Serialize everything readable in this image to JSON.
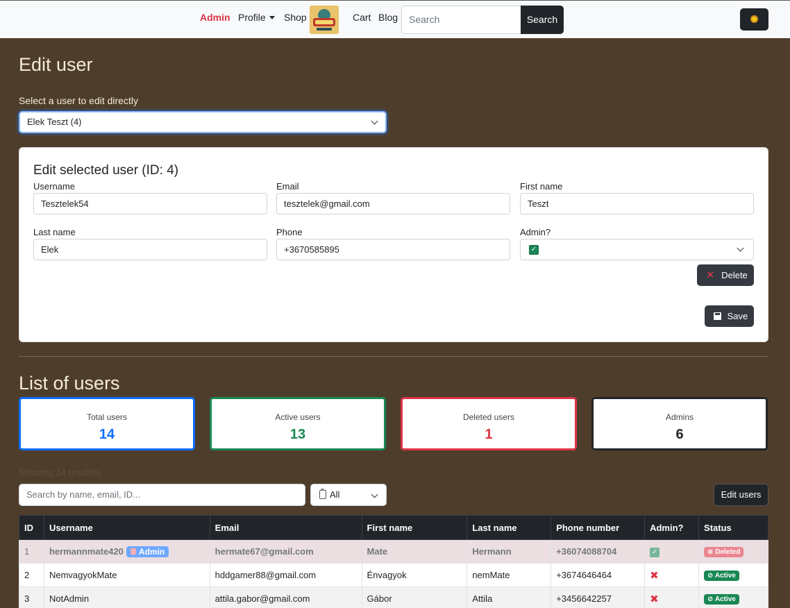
{
  "nav": {
    "admin": "Admin",
    "profile": "Profile",
    "shop": "Shop",
    "cart": "Cart",
    "blog": "Blog",
    "search_placeholder": "Search",
    "search_button": "Search"
  },
  "edit": {
    "title": "Edit user",
    "select_label": "Select a user to edit directly",
    "selected_user": "Elek Teszt (4)",
    "card_title": "Edit selected user (ID: 4)",
    "fields": {
      "username_label": "Username",
      "username": "Tesztelek54",
      "email_label": "Email",
      "email": "tesztelek@gmail.com",
      "firstname_label": "First name",
      "firstname": "Teszt",
      "lastname_label": "Last name",
      "lastname": "Elek",
      "phone_label": "Phone",
      "phone": "+3670585895",
      "admin_label": "Admin?"
    },
    "delete_button": "Delete",
    "save_button": "Save"
  },
  "list": {
    "title": "List of users",
    "stats": [
      {
        "label": "Total users",
        "value": "14",
        "color": "#0d6efd"
      },
      {
        "label": "Active users",
        "value": "13",
        "color": "#198754"
      },
      {
        "label": "Deleted users",
        "value": "1",
        "color": "#dc3545"
      },
      {
        "label": "Admins",
        "value": "6",
        "color": "#212529"
      }
    ],
    "showing": "Showing 14 result(s)",
    "filter_placeholder": "Search by name, email, ID...",
    "filter_select": "All",
    "edit_users_button": "Edit users",
    "columns": [
      "ID",
      "Username",
      "Email",
      "First name",
      "Last name",
      "Phone number",
      "Admin?",
      "Status"
    ],
    "rows": [
      {
        "id": "1",
        "username": "hermannmate420",
        "admin_badge": "Admin",
        "email": "hermate67@gmail.com",
        "first": "Mate",
        "last": "Hermann",
        "phone": "+36074088704",
        "status": "Deleted"
      },
      {
        "id": "2",
        "username": "NemvagyokMate",
        "email": "hddgamer88@gmail.com",
        "first": "Énvagyok",
        "last": "nemMate",
        "phone": "+3674646464",
        "status": "Active"
      },
      {
        "id": "3",
        "username": "NotAdmin",
        "email": "attila.gabor@gmail.com",
        "first": "Gábor",
        "last": "Attila",
        "phone": "+3456642257",
        "status": "Active"
      }
    ]
  }
}
